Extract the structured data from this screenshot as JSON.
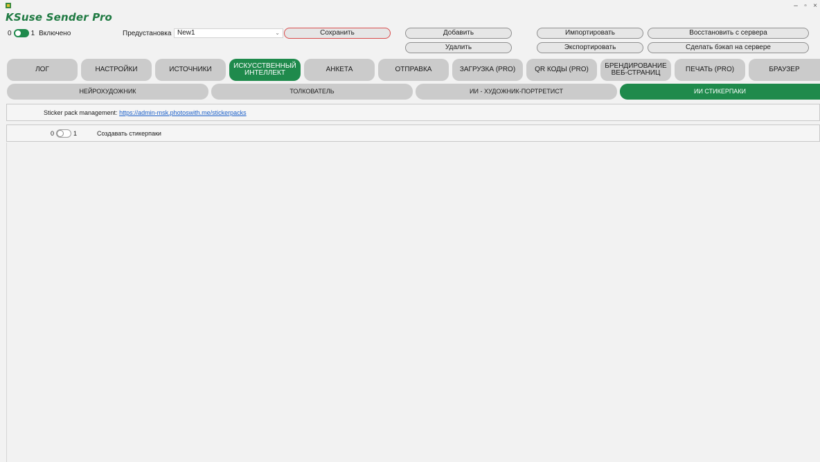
{
  "window": {
    "title": "KSuse Sender Pro",
    "controls": {
      "minimize": "–",
      "maximize": "▫",
      "close": "×"
    }
  },
  "top": {
    "enabled_toggle": {
      "off_label": "0",
      "on_label": "1",
      "state": "on",
      "text": "Включено"
    },
    "preset_label": "Предустановка",
    "preset_value": "New1",
    "buttons": {
      "save": "Сохранить",
      "add": "Добавить",
      "delete": "Удалить",
      "import": "Импортировать",
      "export": "Экспортировать",
      "restore": "Восстановить с сервера",
      "backup": "Сделать бэкап на сервере"
    }
  },
  "tabs": [
    {
      "label": "ЛОГ"
    },
    {
      "label": "НАСТРОЙКИ"
    },
    {
      "label": "ИСТОЧНИКИ"
    },
    {
      "label": "ИСКУССТВЕННЫЙ ИНТЕЛЛЕКТ",
      "line1": "ИСКУССТВЕННЫЙ",
      "line2": "ИНТЕЛЛЕКТ",
      "active": true
    },
    {
      "label": "АНКЕТА"
    },
    {
      "label": "ОТПРАВКА"
    },
    {
      "label": "ЗАГРУЗКА (PRO)"
    },
    {
      "label": "QR КОДЫ (PRO)"
    },
    {
      "label": "БРЕНДИРОВАНИЕ ВЕБ-СТРАНИЦ",
      "line1": "БРЕНДИРОВАНИЕ",
      "line2": "ВЕБ-СТРАНИЦ"
    },
    {
      "label": "ПЕЧАТЬ (PRO)"
    },
    {
      "label": "БРАУЗЕР"
    }
  ],
  "subtabs": [
    {
      "label": "НЕЙРОХУДОЖНИК"
    },
    {
      "label": "ТОЛКОВАТЕЛЬ"
    },
    {
      "label": "ИИ - ХУДОЖНИК-ПОРТРЕТИСТ"
    },
    {
      "label": "ИИ СТИКЕРПАКИ",
      "active": true
    }
  ],
  "sticker": {
    "management_label": "Sticker pack management:",
    "management_url": "https://admin-msk.photoswith.me/stickerpacks",
    "create_toggle": {
      "off_label": "0",
      "on_label": "1",
      "state": "off",
      "text": "Создавать стикерпаки"
    }
  },
  "colors": {
    "accent": "#1f8a4c",
    "title": "#1f7a42",
    "tab_inactive": "#cbcbcb",
    "link": "#1a5fc9",
    "save_border": "#d84a4a"
  }
}
